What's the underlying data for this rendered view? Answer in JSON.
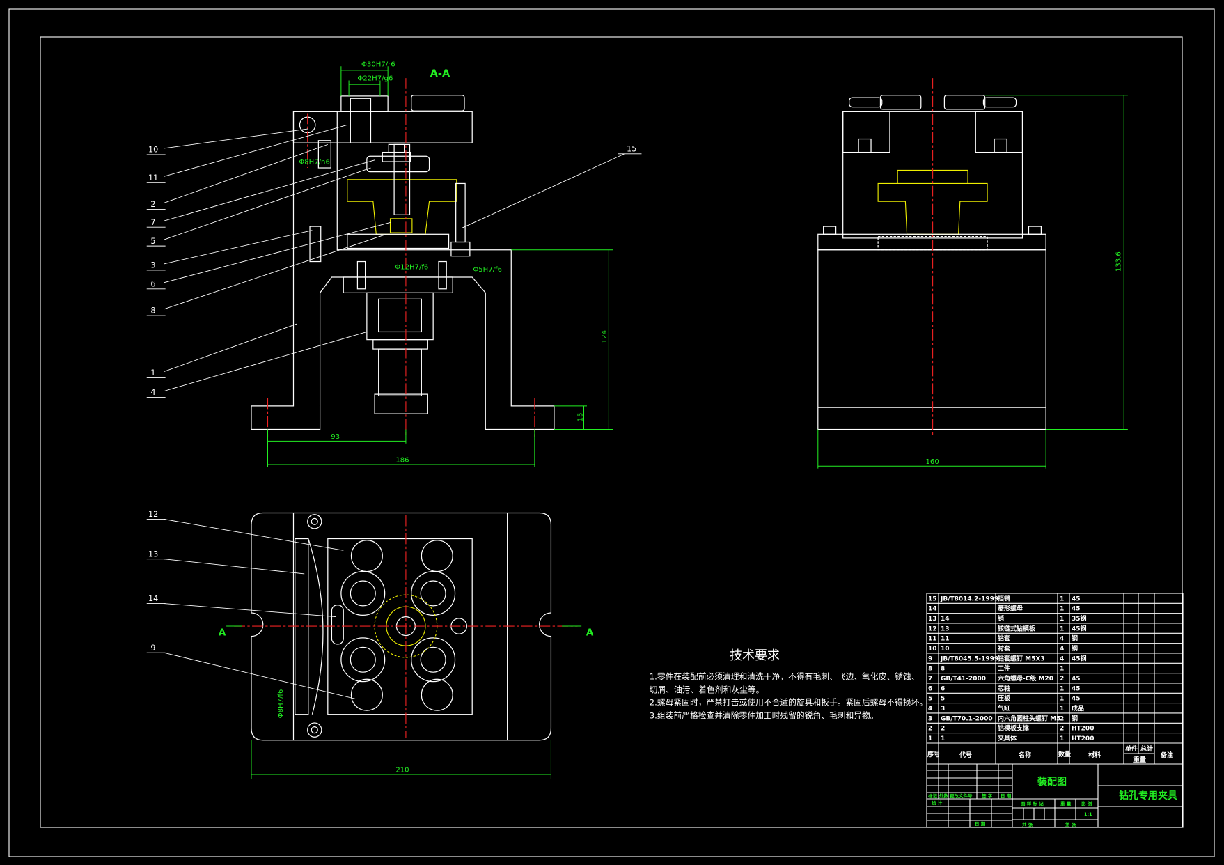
{
  "drawing": {
    "section_label": "A-A",
    "cut_marks": [
      "A",
      "A"
    ],
    "dimensions": {
      "bushing_outer": "Φ30H7/r6",
      "bushing_inner": "Φ22H7/g6",
      "pin_hole": "Φ8H7/n6",
      "center_bore": "Φ12H7/f6",
      "side_hole": "Φ5H7/f6",
      "bottom_hole": "Φ8H7/f6",
      "half_width": "93",
      "base_width": "186",
      "base_height": "124",
      "foot_height": "15",
      "side_width": "160",
      "total_height": "133.6",
      "plan_width": "210"
    },
    "callouts_section": [
      "10",
      "11",
      "2",
      "7",
      "5",
      "3",
      "6",
      "8",
      "1",
      "4",
      "15"
    ],
    "callouts_plan": [
      "12",
      "13",
      "14",
      "9"
    ]
  },
  "tech_requirements": {
    "title": "技术要求",
    "lines": [
      "1.零件在装配前必须清理和清洗干净，不得有毛刺、飞边、氧化皮、锈蚀、",
      "切屑、油污、着色剂和灰尘等。",
      "2.螺母紧固时，严禁打击或使用不合适的旋具和扳手。紧固后螺母不得损坏。",
      "3.组装前严格检查并清除零件加工时残留的锐角、毛刺和异物。"
    ]
  },
  "parts_list": {
    "rows": [
      [
        "15",
        "JB/T8014.2-1999",
        "挡销",
        "1",
        "45"
      ],
      [
        "14",
        "",
        "菱形螺母",
        "1",
        "45"
      ],
      [
        "13",
        "14",
        "销",
        "1",
        "35钢"
      ],
      [
        "12",
        "13",
        "铰链式钻模板",
        "1",
        "45钢"
      ],
      [
        "11",
        "11",
        "钻套",
        "4",
        "钢"
      ],
      [
        "10",
        "10",
        "衬套",
        "4",
        "钢"
      ],
      [
        "9",
        "JB/T8045.5-1999",
        "钻套螺钉 M5X3",
        "4",
        "45钢"
      ],
      [
        "8",
        "8",
        "工件",
        "1",
        ""
      ],
      [
        "7",
        "GB/T41-2000",
        "六角螺母-C级 M20",
        "2",
        "45"
      ],
      [
        "6",
        "6",
        "芯轴",
        "1",
        "45"
      ],
      [
        "5",
        "5",
        "压板",
        "1",
        "45"
      ],
      [
        "4",
        "3",
        "气缸",
        "1",
        "成品"
      ],
      [
        "3",
        "GB/T70.1-2000",
        "内六角圆柱头螺钉 M5",
        "2",
        "钢"
      ],
      [
        "2",
        "2",
        "钻模板支撑",
        "2",
        "HT200"
      ],
      [
        "1",
        "1",
        "夹具体",
        "1",
        "HT200"
      ]
    ],
    "header": {
      "index": "序号",
      "code": "代号",
      "name": "名称",
      "qty": "数量",
      "material": "材料",
      "unit_weight": "单件",
      "total_weight": "总计",
      "weight": "重量",
      "remark": "备注"
    }
  },
  "title_block": {
    "drawing_type": "装配图",
    "drawing_name": "钻孔专用夹具",
    "scale": "1:1",
    "labels": {
      "mark": "标记",
      "count": "处数",
      "change_doc": "更改文件号",
      "sign": "签 字",
      "date": "日 期",
      "design": "设 计",
      "date2": "日 期",
      "stage_mark": "图 样 标 记",
      "weight": "重 量",
      "ratio": "比 例",
      "sheet": "共     张",
      "sheet_no": "第     张"
    }
  },
  "colors": {
    "background": "#000000",
    "outline": "#ffffff",
    "hatch": "#55eeee",
    "centerline": "#ee2222",
    "dimension": "#22ee22",
    "workpiece": "#eeee00"
  }
}
